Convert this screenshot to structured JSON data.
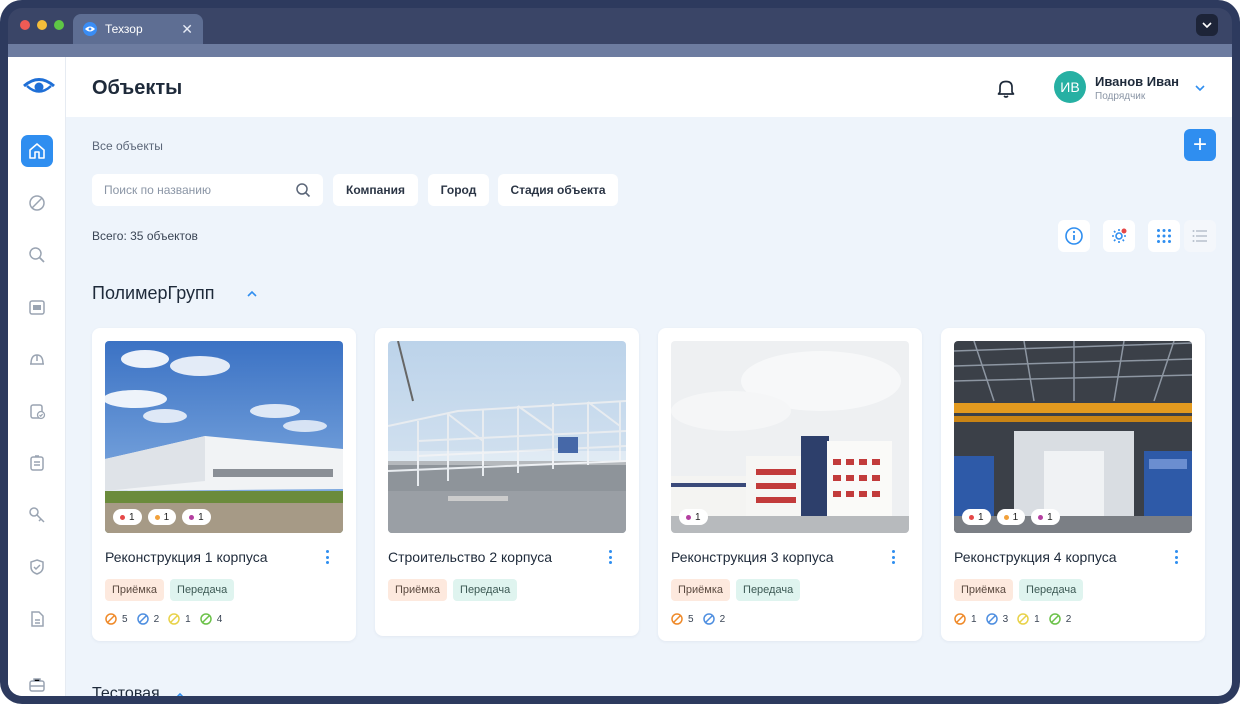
{
  "window": {
    "tab_title": "Техзор",
    "tab_close": "✕"
  },
  "header": {
    "title": "Объекты",
    "user": {
      "initials": "ИВ",
      "name": "Иванов Иван",
      "role": "Подрядчик"
    }
  },
  "breadcrumb": "Все объекты",
  "add_button": "+",
  "search": {
    "placeholder": "Поиск по названию",
    "value": ""
  },
  "filters": [
    "Компания",
    "Город",
    "Стадия  объекта"
  ],
  "total": "Всего: 35 объектов",
  "colors": {
    "accent": "#2f8ef0",
    "red": "#e54848",
    "orange": "#f2a13b",
    "purple": "#b43fa0",
    "yellow": "#e8d24a",
    "green": "#6cc24a",
    "blue": "#4f8fe0",
    "orange_icon": "#ef8a2a"
  },
  "groups": [
    {
      "name": "ПолимерГрупп",
      "cards": [
        {
          "title": "Реконструкция 1 корпуса",
          "badges": [
            "1",
            "1",
            "1"
          ],
          "tags": [
            "Приёмка",
            "Передача"
          ],
          "counts": [
            "5",
            "2",
            "1",
            "4"
          ]
        },
        {
          "title": "Строительство 2 корпуса",
          "badges": [],
          "tags": [
            "Приёмка",
            "Передача"
          ],
          "counts": []
        },
        {
          "title": "Реконструкция 3 корпуса",
          "badges": [
            "1"
          ],
          "tags": [
            "Приёмка",
            "Передача"
          ],
          "counts": [
            "5",
            "2"
          ]
        },
        {
          "title": "Реконструкция 4 корпуса",
          "badges": [
            "1",
            "1",
            "1"
          ],
          "tags": [
            "Приёмка",
            "Передача"
          ],
          "counts": [
            "1",
            "3",
            "1",
            "2"
          ]
        }
      ]
    },
    {
      "name": "Тестовая"
    }
  ]
}
